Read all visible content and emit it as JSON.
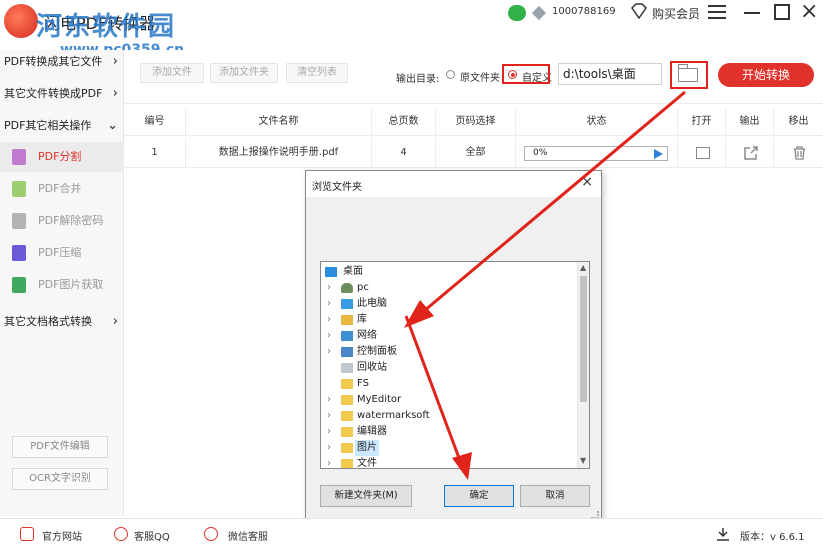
{
  "app": {
    "title": "闪电PDF转换器",
    "phone": "1000788169",
    "vip_label": "购买会员"
  },
  "watermark": {
    "logo_text": "河东软件园",
    "url": "www.pc0359.cn"
  },
  "sidebar": {
    "sections": [
      {
        "label": "PDF转换成其它文件",
        "chevron": "›"
      },
      {
        "label": "其它文件转换成PDF",
        "chevron": "›"
      },
      {
        "label": "PDF其它相关操作",
        "chevron": "⌄"
      },
      {
        "label": "其它文档格式转换",
        "chevron": "›"
      }
    ],
    "items": [
      {
        "label": "PDF分割",
        "color": "#c07ad0"
      },
      {
        "label": "PDF合并",
        "color": "#9ccd6f"
      },
      {
        "label": "PDF解除密码",
        "color": "#b3b3b3"
      },
      {
        "label": "PDF压缩",
        "color": "#6a5ad8"
      },
      {
        "label": "PDF图片获取",
        "color": "#3faa5d"
      }
    ],
    "buttons": {
      "edit": "PDF文件编辑",
      "ocr": "OCR文字识别"
    }
  },
  "toolbar": {
    "add_file": "添加文件",
    "add_folder": "添加文件夹",
    "clear_list": "清空列表",
    "output_label": "输出目录:",
    "option_original": "原文件夹",
    "option_custom": "自定义",
    "output_path": "d:\\tools\\桌面",
    "start": "开始转换"
  },
  "table": {
    "headers": [
      "编号",
      "文件名称",
      "总页数",
      "页码选择",
      "状态",
      "打开",
      "输出",
      "移出"
    ],
    "rows": [
      {
        "index": "1",
        "name": "数据上报操作说明手册.pdf",
        "pages": "4",
        "range": "全部",
        "status": "0%"
      }
    ]
  },
  "dialog": {
    "title": "浏览文件夹",
    "close": "×",
    "tree": [
      {
        "label": "桌面",
        "icon": "desktop-icon",
        "level": 0,
        "twisty": ""
      },
      {
        "label": "pc",
        "icon": "user-icon",
        "level": 1,
        "twisty": "›"
      },
      {
        "label": "此电脑",
        "icon": "computer-icon",
        "level": 1,
        "twisty": "›"
      },
      {
        "label": "库",
        "icon": "library-icon",
        "level": 1,
        "twisty": "›"
      },
      {
        "label": "网络",
        "icon": "network-icon",
        "level": 1,
        "twisty": "›"
      },
      {
        "label": "控制面板",
        "icon": "control-panel-icon",
        "level": 1,
        "twisty": "›"
      },
      {
        "label": "回收站",
        "icon": "recycle-bin-icon",
        "level": 1,
        "twisty": ""
      },
      {
        "label": "FS",
        "icon": "folder-icon",
        "level": 1,
        "twisty": ""
      },
      {
        "label": "MyEditor",
        "icon": "folder-icon",
        "level": 1,
        "twisty": "›"
      },
      {
        "label": "watermarksoft",
        "icon": "folder-icon",
        "level": 1,
        "twisty": "›"
      },
      {
        "label": "编辑器",
        "icon": "folder-icon",
        "level": 1,
        "twisty": "›"
      },
      {
        "label": "图片",
        "icon": "folder-icon",
        "level": 1,
        "twisty": "›",
        "selected": true
      },
      {
        "label": "文件",
        "icon": "folder-icon",
        "level": 1,
        "twisty": "›"
      }
    ],
    "new_folder": "新建文件夹(M)",
    "ok": "确定",
    "cancel": "取消"
  },
  "footer": {
    "website": "官方网站",
    "qq": "客服QQ",
    "wechat": "微信客服",
    "version": "版本：v 6.6.1"
  },
  "colors": {
    "accent": "#e0322b",
    "highlight": "#e0231b",
    "selection": "#cce8ff"
  }
}
